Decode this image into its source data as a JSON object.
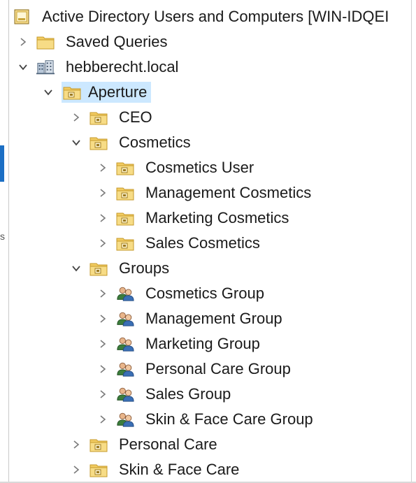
{
  "tree": {
    "root": {
      "label": "Active Directory Users and Computers [WIN-IDQEI",
      "icon": "aduc-snapin-icon"
    },
    "saved_queries": {
      "label": "Saved Queries",
      "icon": "folder-icon"
    },
    "domain": {
      "label": "hebberecht.local",
      "icon": "domain-icon"
    },
    "aperture": {
      "label": "Aperture",
      "icon": "ou-icon",
      "selected": true
    },
    "ceo": {
      "label": "CEO",
      "icon": "ou-icon"
    },
    "cosmetics": {
      "label": "Cosmetics",
      "icon": "ou-icon",
      "children": [
        {
          "label": "Cosmetics User",
          "icon": "ou-icon"
        },
        {
          "label": "Management Cosmetics",
          "icon": "ou-icon"
        },
        {
          "label": "Marketing Cosmetics",
          "icon": "ou-icon"
        },
        {
          "label": "Sales Cosmetics",
          "icon": "ou-icon"
        }
      ]
    },
    "groups": {
      "label": "Groups",
      "icon": "ou-icon",
      "children": [
        {
          "label": "Cosmetics Group",
          "icon": "group-icon"
        },
        {
          "label": "Management Group",
          "icon": "group-icon"
        },
        {
          "label": "Marketing Group",
          "icon": "group-icon"
        },
        {
          "label": "Personal Care Group",
          "icon": "group-icon"
        },
        {
          "label": "Sales Group",
          "icon": "group-icon"
        },
        {
          "label": "Skin & Face Care Group",
          "icon": "group-icon"
        }
      ]
    },
    "personal_care": {
      "label": "Personal Care",
      "icon": "ou-icon"
    },
    "skin_face_care": {
      "label": "Skin & Face Care",
      "icon": "ou-icon"
    }
  },
  "colors": {
    "selection": "#cce8ff",
    "folder": "#f2cc62",
    "chevron": "#7a7a7a"
  }
}
